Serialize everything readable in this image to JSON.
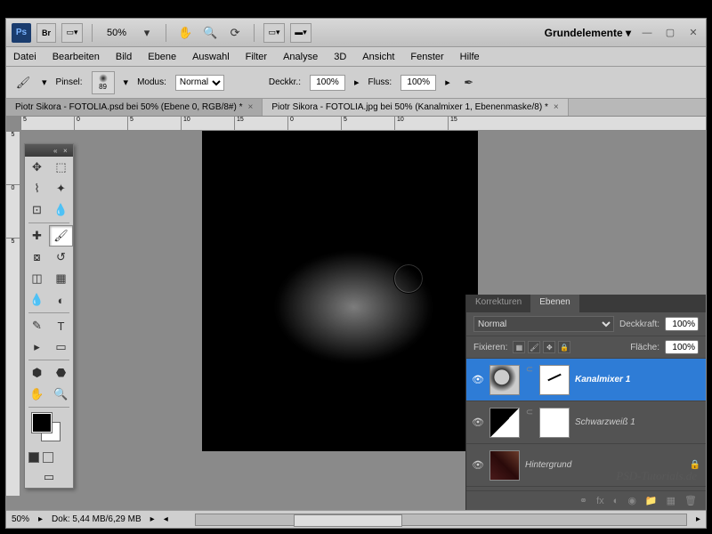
{
  "titlebar": {
    "zoom": "50%",
    "workspace": "Grundelemente"
  },
  "menu": [
    "Datei",
    "Bearbeiten",
    "Bild",
    "Ebene",
    "Auswahl",
    "Filter",
    "Analyse",
    "3D",
    "Ansicht",
    "Fenster",
    "Hilfe"
  ],
  "options": {
    "pinsel_lbl": "Pinsel:",
    "brush_size": "89",
    "modus_lbl": "Modus:",
    "modus_val": "Normal",
    "deckkr_lbl": "Deckkr.:",
    "deckkr_val": "100%",
    "fluss_lbl": "Fluss:",
    "fluss_val": "100%"
  },
  "tabs": [
    {
      "label": "Piotr Sikora - FOTOLIA.psd bei 50% (Ebene 0, RGB/8#) *",
      "active": true
    },
    {
      "label": "Piotr Sikora - FOTOLIA.jpg bei 50% (Kanalmixer 1, Ebenenmaske/8) *",
      "active": false
    }
  ],
  "ruler_h": [
    "5",
    "0",
    "5",
    "10",
    "15",
    "0",
    "5",
    "10",
    "15"
  ],
  "ruler_v": [
    "5",
    "0",
    "5"
  ],
  "panel": {
    "tabs": [
      "Korrekturen",
      "Ebenen"
    ],
    "active_tab": 1,
    "blend_mode": "Normal",
    "deckkraft_lbl": "Deckkraft:",
    "deckkraft_val": "100%",
    "fixieren_lbl": "Fixieren:",
    "flaeche_lbl": "Fläche:",
    "flaeche_val": "100%",
    "layers": [
      {
        "name": "Kanalmixer 1",
        "sel": true,
        "type": "adj",
        "mask": true
      },
      {
        "name": "Schwarzweiß 1",
        "sel": false,
        "type": "bw",
        "mask": true
      },
      {
        "name": "Hintergrund",
        "sel": false,
        "type": "bg"
      }
    ]
  },
  "status": {
    "zoom": "50%",
    "doc": "Dok: 5,44 MB/6,29 MB"
  },
  "watermark": "PSD-Tutorials.de"
}
